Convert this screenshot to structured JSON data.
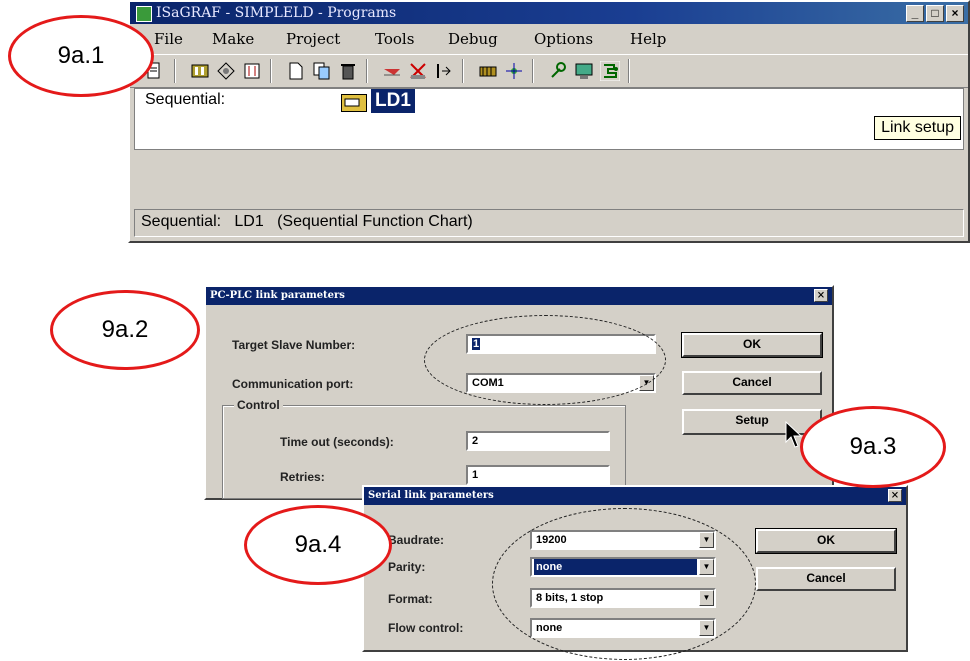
{
  "main_window": {
    "title": "ISaGRAF - SIMPLELD - Programs",
    "controls": {
      "minimize": "_",
      "maximize": "□",
      "close": "×"
    },
    "menu": [
      "File",
      "Make",
      "Project",
      "Tools",
      "Debug",
      "Options",
      "Help"
    ],
    "content": {
      "section_label": "Sequential:",
      "program_name": "LD1",
      "tooltip": "Link setup"
    },
    "status": "Sequential:   LD1   (Sequential Function Chart)"
  },
  "link_dialog": {
    "title": "PC-PLC link parameters",
    "close": "×",
    "target_slave_label": "Target Slave Number:",
    "target_slave_value": "1",
    "comm_port_label": "Communication port:",
    "comm_port_value": "COM1",
    "control_group": "Control",
    "timeout_label": "Time out (seconds):",
    "timeout_value": "2",
    "retries_label": "Retries:",
    "retries_value": "1",
    "ok": "OK",
    "cancel": "Cancel",
    "setup": "Setup"
  },
  "serial_dialog": {
    "title": "Serial link parameters",
    "close": "×",
    "baudrate_label": "Baudrate:",
    "baudrate_value": "19200",
    "parity_label": "Parity:",
    "parity_value": "none",
    "format_label": "Format:",
    "format_value": "8 bits, 1 stop",
    "flow_label": "Flow control:",
    "flow_value": "none",
    "ok": "OK",
    "cancel": "Cancel"
  },
  "callouts": [
    "9a.1",
    "9a.2",
    "9a.3",
    "9a.4"
  ],
  "colors": {
    "callout_border": "#e41a1a",
    "titlebar": "#0a246a",
    "selection": "#0a246a"
  }
}
